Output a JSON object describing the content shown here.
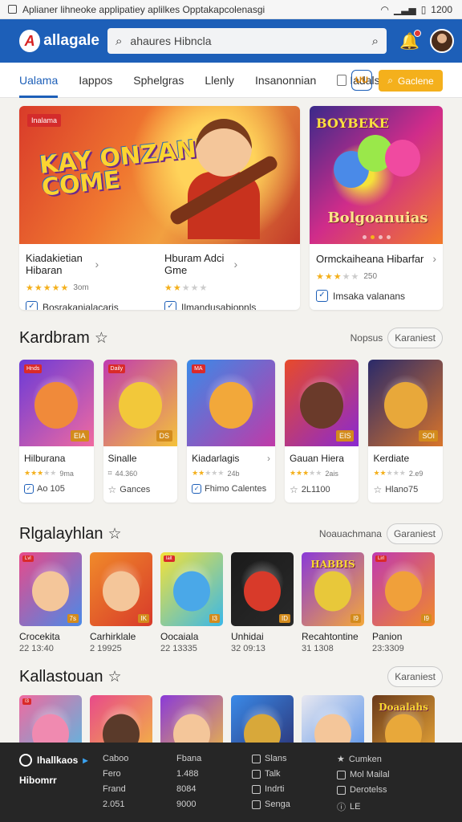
{
  "status": {
    "title": "Aplianer lihneoke applipatiey aplilkes Opptakapcolenasgi",
    "time": "1200"
  },
  "header": {
    "brand": "allagale",
    "search_value": "ahaures Hibncla"
  },
  "tabs": [
    "Ualama",
    "Iappos",
    "Sphelgras",
    "Llenly",
    "Insanonnian",
    "Iadals"
  ],
  "tab_square_label": "UU",
  "cta_label": "Gaclene",
  "featured": {
    "banner_tag": "Inalama",
    "banner_art_title": "KAY ONZANIOY COME",
    "side_art_top": "BOYBEKE",
    "side_art_title": "Bolgoanuias",
    "left_name": "Kiadakietian Hibaran",
    "left_stars": 5,
    "left_count": "3om",
    "left_sub": "Bosrakanialacaris",
    "mid_name": "Hburam Adci Gme",
    "mid_stars": 2,
    "mid_sub": "Ilmandusabiopnls",
    "right_name": "Ormckaiheana Hibarfar",
    "right_stars": 3,
    "right_count": "250",
    "right_sub": "Imsaka valanans"
  },
  "section1": {
    "title": "Kardbram",
    "link": "Nopsus",
    "pill": "Karaniest",
    "cards": [
      {
        "name": "Hilburana",
        "stars": 3,
        "count": "9ma",
        "sub": "Ao 105",
        "sub_icon": "check",
        "badge_tl": "Hnds",
        "badge_br": "EIA",
        "color1": "#6a3ad8",
        "color2": "#f06aa0",
        "critter": "#f08a3a"
      },
      {
        "name": "Sinalle",
        "stars": 0,
        "count": "44.360",
        "sub": "Gances",
        "sub_icon": "star",
        "badge_tl": "Daily",
        "badge_br": "DS",
        "color1": "#c03ab0",
        "color2": "#f4c23a",
        "critter": "#f2c83a"
      },
      {
        "name": "Kiadarlagis",
        "stars": 2,
        "count": "24b",
        "sub": "Fhimo Calentes",
        "sub_icon": "check",
        "badge_tl": "MA",
        "badge_br": "",
        "color1": "#3a8ae8",
        "color2": "#c03aa8",
        "critter": "#f2a83a"
      },
      {
        "name": "Gauan Hiera",
        "stars": 3,
        "count": "2ais",
        "sub": "2L1100",
        "sub_icon": "star",
        "badge_tl": "",
        "badge_br": "EIS",
        "color1": "#e84a2a",
        "color2": "#8a2ad0",
        "critter": "#6a3a2a"
      },
      {
        "name": "Kerdiate",
        "stars": 2,
        "count": "2.e9",
        "sub": "Hlano75",
        "sub_icon": "star",
        "badge_tl": "",
        "badge_br": "SOI",
        "color1": "#2a2a6a",
        "color2": "#d8742a",
        "critter": "#e8a83a"
      }
    ]
  },
  "section2": {
    "title": "Rlgalayhlan",
    "link": "Noauachmana",
    "pill": "Garaniest",
    "cards": [
      {
        "name": "Crocekita",
        "val": "22 13:40",
        "badge_tl": "Lvl",
        "badge_br": "7s",
        "c1": "#e84a8a",
        "c2": "#4a8ae8",
        "critter": "#f4c69a",
        "title": ""
      },
      {
        "name": "Carhirklale",
        "val": "2 19925",
        "badge_tl": "",
        "badge_br": "IK",
        "c1": "#f08a2a",
        "c2": "#d83a2a",
        "critter": "#f4c69a",
        "title": ""
      },
      {
        "name": "Oocaiala",
        "val": "22 13335",
        "badge_tl": "lalt",
        "badge_br": "I3",
        "c1": "#f4e23a",
        "c2": "#3ab8e8",
        "critter": "#4aa8e8",
        "title": ""
      },
      {
        "name": "Unhidai",
        "val": "32 09:13",
        "badge_tl": "",
        "badge_br": "ID",
        "c1": "#1a1a1a",
        "c2": "#2a2a2a",
        "critter": "#d83a2a",
        "title": ""
      },
      {
        "name": "Recahtontine",
        "val": "31 1308",
        "badge_tl": "",
        "badge_br": "I9",
        "c1": "#8a3ad8",
        "c2": "#f4a83a",
        "critter": "#e8c83a",
        "title": "HABBIS"
      },
      {
        "name": "Panion",
        "val": "23:3309",
        "badge_tl": "Lirl",
        "badge_br": "I9",
        "c1": "#c03ab0",
        "c2": "#f08a2a",
        "critter": "#f0a03a",
        "title": ""
      }
    ]
  },
  "section3": {
    "title": "Kallastouan",
    "pill": "Karaniest",
    "cards": [
      {
        "c1": "#f06aa0",
        "c2": "#4ac0e8",
        "critter": "#f08ab0",
        "badge_tl": "I3"
      },
      {
        "c1": "#e84a8a",
        "c2": "#f4c23a",
        "critter": "#5a3a2a",
        "badge_tl": ""
      },
      {
        "c1": "#8a3ad8",
        "c2": "#f4c23a",
        "critter": "#f4c69a",
        "badge_tl": ""
      },
      {
        "c1": "#3a8ae8",
        "c2": "#2a2a6a",
        "critter": "#d8a83a",
        "badge_tl": ""
      },
      {
        "c1": "#e8e8f0",
        "c2": "#4a8ae8",
        "critter": "#f4c69a",
        "badge_tl": ""
      },
      {
        "c1": "#6a3a1a",
        "c2": "#f4b03a",
        "critter": "#e8a83a",
        "badge_tl": "",
        "title": "Doaalahs"
      }
    ]
  },
  "footer": {
    "brand1": "Ihallkaos",
    "brand2": "Hibomrr",
    "col1": [
      "Caboo",
      "Fero",
      "Frand",
      "2.051"
    ],
    "col2": [
      "Fbana",
      "1.488",
      "8084",
      "9000"
    ],
    "col3": [
      "Slans",
      "Talk",
      "Indrti",
      "Senga"
    ],
    "col4": [
      "Cumken",
      "Mol Mailal",
      "Derotelss",
      "LE"
    ]
  }
}
